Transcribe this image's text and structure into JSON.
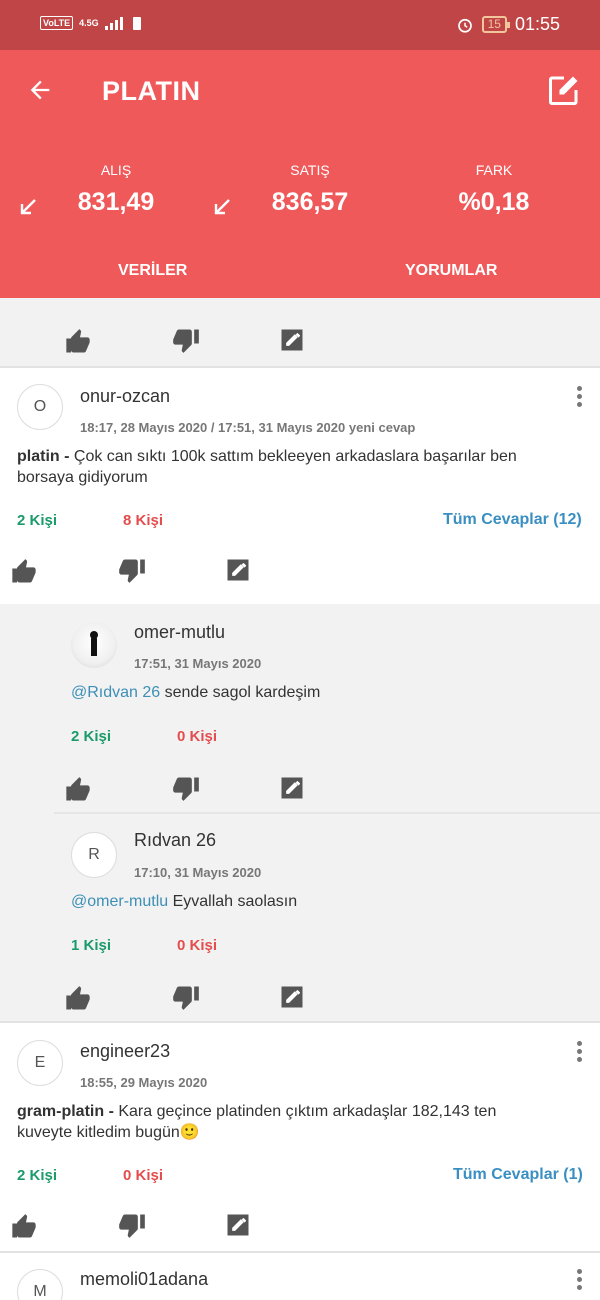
{
  "statusbar": {
    "volte": "VoLTE",
    "network": "4.5G",
    "battery": "15",
    "time": "01:55"
  },
  "header": {
    "title": "PLATIN"
  },
  "prices": {
    "buy_label": "ALIŞ",
    "buy_value": "831,49",
    "sell_label": "SATIŞ",
    "sell_value": "836,57",
    "diff_label": "FARK",
    "diff_value": "%0,18"
  },
  "tabs": {
    "data": "VERİLER",
    "comments": "YORUMLAR"
  },
  "comments": [
    {
      "avatar": "O",
      "user": "onur-ozcan",
      "meta": "18:17, 28 Mayıs 2020 / 17:51, 31 Mayıs 2020 yeni cevap",
      "topic": "platin - ",
      "text": "Çok can sıktı 100k sattım bekleeyen arkadaslara başarılar ben borsaya gidiyorum",
      "likes": "2 Kişi",
      "dislikes": "8 Kişi",
      "all_replies": "Tüm Cevaplar (12)"
    },
    {
      "user": "omer-mutlu",
      "meta": "17:51, 31 Mayıs 2020",
      "mention": "@Rıdvan 26",
      "text": " sende sagol kardeşim",
      "likes": "2 Kişi",
      "dislikes": "0 Kişi"
    },
    {
      "avatar": "R",
      "user": "Rıdvan 26",
      "meta": "17:10, 31 Mayıs 2020",
      "mention": "@omer-mutlu",
      "text": " Eyvallah saolasın",
      "likes": "1 Kişi",
      "dislikes": "0 Kişi"
    },
    {
      "avatar": "E",
      "user": "engineer23",
      "meta": "18:55, 29 Mayıs 2020",
      "topic": "gram-platin - ",
      "text": "Kara geçince platinden çıktım arkadaşlar 182,143 ten kuveyte kitledim bugün🙂",
      "likes": "2 Kişi",
      "dislikes": "0 Kişi",
      "all_replies": "Tüm Cevaplar (1)"
    },
    {
      "avatar": "M",
      "user": "memoli01adana"
    }
  ],
  "icons": {
    "like": "thumb-up-icon",
    "dislike": "thumb-down-icon",
    "reply": "edit-icon",
    "more": "more-vertical-icon",
    "back": "arrow-left-icon",
    "compose": "compose-icon"
  },
  "colors": {
    "header": "#f0595a",
    "statusbar": "#c04546",
    "like": "#1b9b6a",
    "dislike": "#e44d4d",
    "link": "#3a8fc2"
  }
}
